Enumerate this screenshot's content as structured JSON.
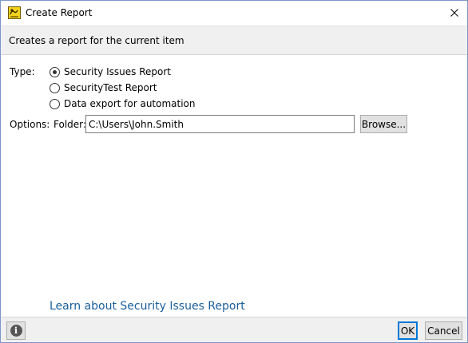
{
  "window": {
    "title": "Create Report",
    "app_icon": "report-app-icon",
    "close_icon": "close-icon"
  },
  "header": {
    "description": "Creates a report for the current item"
  },
  "type": {
    "label": "Type:",
    "options": [
      {
        "label": "Security Issues Report",
        "selected": true
      },
      {
        "label": "SecurityTest Report",
        "selected": false
      },
      {
        "label": "Data export for automation",
        "selected": false
      }
    ]
  },
  "options": {
    "label": "Options:",
    "folder_label": "Folder:",
    "folder_value": "C:\\Users\\John.Smith",
    "browse_label": "Browse..."
  },
  "link": {
    "text": "Learn about Security Issues Report"
  },
  "footer": {
    "info_icon": "info-icon",
    "info_glyph": "i",
    "ok_label": "OK",
    "cancel_label": "Cancel"
  },
  "colors": {
    "link": "#1a5e9a",
    "header_band": "#f0f0f0",
    "ok_border": "#0078d7"
  }
}
